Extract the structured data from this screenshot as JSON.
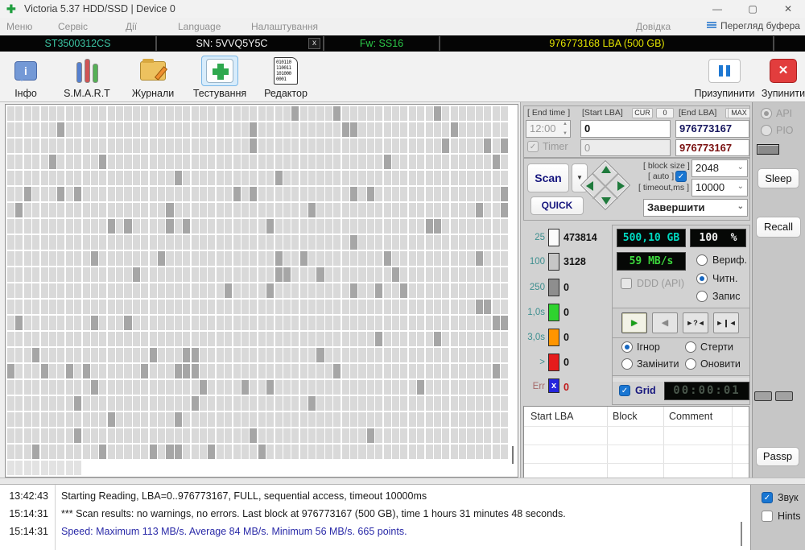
{
  "window": {
    "title": "Victoria 5.37 HDD/SSD | Device 0"
  },
  "menubar": {
    "items": [
      "Меню",
      "Сервіс",
      "Дії",
      "Language",
      "Налаштування"
    ],
    "help": "Довідка",
    "buffer_view": "Перегляд буфера"
  },
  "devicebar": {
    "model": "ST3500312CS",
    "serial": "SN: 5VVQ5Y5C",
    "close": "x",
    "firmware": "Fw: SS16",
    "capacity": "976773168 LBA (500 GB)"
  },
  "toolbar": {
    "info": "Інфо",
    "smart": "S.M.A.R.T",
    "journals": "Журнали",
    "testing": "Тестування",
    "editor": "Редактор",
    "editor_icon_text": "010110 110011 101000 0001",
    "pause": "Призупинити",
    "stop": "Зупинити"
  },
  "scan_controls": {
    "end_time_label": "[ End time ]",
    "end_time_value": "12:00",
    "start_lba_label": "[Start LBA]",
    "cur_label": "CUR",
    "zero_label": "0",
    "start_lba_value": "0",
    "end_lba_label": "[End LBA]",
    "max_label": "MAX",
    "end_lba_value": "976773167",
    "end_lba_current": "976773167",
    "timer_label": "Timer",
    "timer_value": "0",
    "scan_button": "Scan",
    "quick_button": "QUICK",
    "block_size_label": "[ block size ]",
    "auto_label": "[ auto ]",
    "block_size_value": "2048",
    "timeout_label": "[ timeout,ms ]",
    "timeout_value": "10000",
    "after_action": "Завершити"
  },
  "stats": {
    "rows": [
      {
        "label": "25",
        "color": "#fbfbfb",
        "value": "473814"
      },
      {
        "label": "100",
        "color": "#c6c6c6",
        "value": "3128"
      },
      {
        "label": "250",
        "color": "#8e8e8e",
        "value": "0"
      },
      {
        "label": "1,0s",
        "color": "#2fd32f",
        "value": "0"
      },
      {
        "label": "3,0s",
        "color": "#ff9500",
        "value": "0"
      },
      {
        "label": ">",
        "color": "#e51c1c",
        "value": "0"
      },
      {
        "label": "Err",
        "color": "#2525dd",
        "value": "0",
        "err_mark": "x"
      }
    ]
  },
  "readout": {
    "capacity": "500,10 GB",
    "percent": "100",
    "percent_unit": "%",
    "speed": "59 MB/s",
    "ddd_label": "DDD (API)",
    "mode_options": [
      "Вериф.",
      "Читн.",
      "Запис"
    ],
    "mode_selected": "Читн."
  },
  "defect_actions": {
    "options": [
      "Ігнор",
      "Стерти",
      "Замінити",
      "Оновити"
    ],
    "selected": "Ігнор"
  },
  "grid_toggle": {
    "label": "Grid",
    "elapsed": "00:00:01"
  },
  "defect_table": {
    "headers": [
      "Start LBA",
      "Block",
      "Comment"
    ]
  },
  "side_controls": {
    "api": "API",
    "pio": "PIO",
    "sleep": "Sleep",
    "recall": "Recall",
    "passp": "Passp"
  },
  "log": {
    "entries": [
      {
        "time": "13:42:43",
        "text": "Starting Reading, LBA=0..976773167, FULL, sequential access, timeout 10000ms",
        "color": "#1a1a1a"
      },
      {
        "time": "15:14:31",
        "text": "*** Scan results: no warnings, no errors. Last block at 976773167 (500 GB), time 1 hours 31 minutes 48 seconds.",
        "color": "#1a1a1a"
      },
      {
        "time": "15:14:31",
        "text": "Speed: Maximum 113 MB/s. Average 84 MB/s. Minimum 56 MB/s. 665 points.",
        "color": "#2a2aa8"
      }
    ]
  },
  "footer_toggles": {
    "sound": "Звук",
    "hints": "Hints"
  },
  "block_grid": {
    "cols": 60,
    "rows": 23,
    "last_row_cells": 9,
    "cell_color": "#d9d9d9",
    "slow_color": "#a6a6a6",
    "last_row_color": "#e2e2e2",
    "slow_ratio": 0.07,
    "seed": 1337
  },
  "icons": {
    "app": "✚",
    "minimize": "—",
    "maximize": "▢",
    "close": "✕",
    "check": "✓",
    "dropdown_arrow": "▼",
    "select_chevron": "⌄",
    "spin_up": "▲",
    "spin_down": "▼",
    "play": "►",
    "reverse": "◄",
    "seek_question": "►?◄",
    "seek_edge": "►❙◄",
    "stop_x": "✕",
    "info": "i"
  }
}
